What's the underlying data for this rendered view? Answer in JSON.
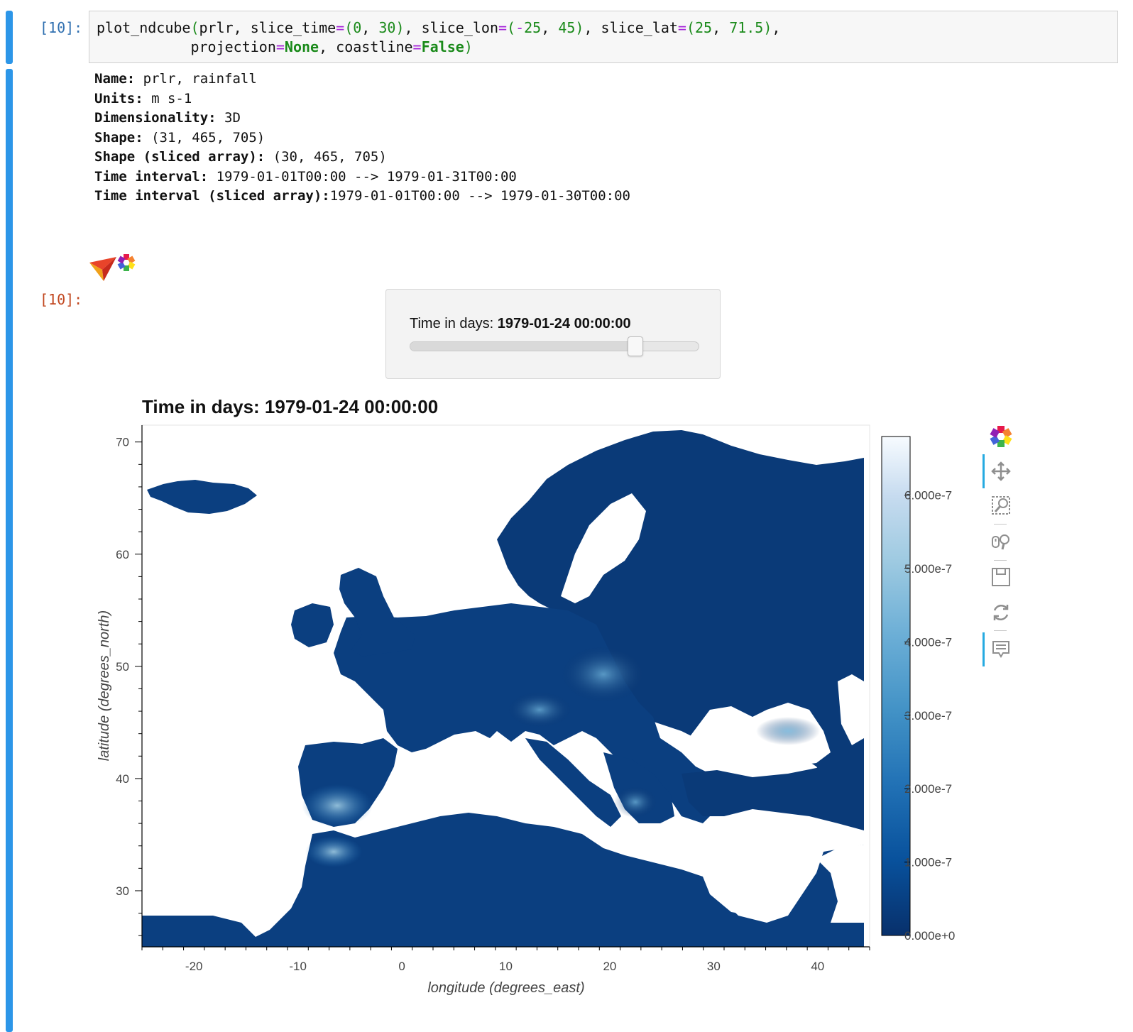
{
  "cell_in": {
    "prompt": "[10]:",
    "code_line1": [
      {
        "t": "plot_ndcube",
        "c": ""
      },
      {
        "t": "(",
        "c": "c-paren"
      },
      {
        "t": "prlr, slice_time",
        "c": ""
      },
      {
        "t": "=",
        "c": "c-op"
      },
      {
        "t": "(",
        "c": "c-paren"
      },
      {
        "t": "0",
        "c": "c-num"
      },
      {
        "t": ", ",
        "c": ""
      },
      {
        "t": "30",
        "c": "c-num"
      },
      {
        "t": ")",
        "c": "c-paren"
      },
      {
        "t": ", slice_lon",
        "c": ""
      },
      {
        "t": "=",
        "c": "c-op"
      },
      {
        "t": "(",
        "c": "c-paren"
      },
      {
        "t": "-",
        "c": "c-op"
      },
      {
        "t": "25",
        "c": "c-num"
      },
      {
        "t": ", ",
        "c": ""
      },
      {
        "t": "45",
        "c": "c-num"
      },
      {
        "t": ")",
        "c": "c-paren"
      },
      {
        "t": ", slice_lat",
        "c": ""
      },
      {
        "t": "=",
        "c": "c-op"
      },
      {
        "t": "(",
        "c": "c-paren"
      },
      {
        "t": "25",
        "c": "c-num"
      },
      {
        "t": ", ",
        "c": ""
      },
      {
        "t": "71.5",
        "c": "c-num"
      },
      {
        "t": ")",
        "c": "c-paren"
      },
      {
        "t": ",",
        "c": ""
      }
    ],
    "code_line2": [
      {
        "t": "           projection",
        "c": ""
      },
      {
        "t": "=",
        "c": "c-op"
      },
      {
        "t": "None",
        "c": "c-kw"
      },
      {
        "t": ", coastline",
        "c": ""
      },
      {
        "t": "=",
        "c": "c-op"
      },
      {
        "t": "False",
        "c": "c-kw"
      },
      {
        "t": ")",
        "c": "c-paren"
      }
    ]
  },
  "cell_out": {
    "prompt": "[10]:",
    "info": [
      {
        "key": "Name:",
        "value": " prlr, rainfall"
      },
      {
        "key": "Units:",
        "value": " m s-1"
      },
      {
        "key": "Dimensionality:",
        "value": " 3D"
      },
      {
        "key": "Shape:",
        "value": " (31, 465, 705)"
      },
      {
        "key": "Shape (sliced array):",
        "value": " (30, 465, 705)"
      },
      {
        "key": "Time interval:",
        "value": " 1979-01-01T00:00 --> 1979-01-31T00:00"
      },
      {
        "key": "Time interval (sliced array):",
        "value": "1979-01-01T00:00 --> 1979-01-30T00:00"
      }
    ]
  },
  "slider": {
    "label": "Time in days: ",
    "value": "1979-01-24 00:00:00",
    "position_fraction": 0.793
  },
  "plot": {
    "title": "Time in days: 1979-01-24 00:00:00"
  },
  "chart_data": {
    "type": "heatmap",
    "title": "Time in days: 1979-01-24 00:00:00",
    "xlabel": "longitude (degrees_east)",
    "ylabel": "latitude (degrees_north)",
    "xlim": [
      -25,
      45
    ],
    "ylim": [
      25,
      71.5
    ],
    "x_ticks": [
      -20,
      -10,
      0,
      10,
      20,
      30,
      40
    ],
    "y_ticks": [
      30,
      40,
      50,
      60,
      70
    ],
    "colorbar": {
      "colormap": "Blues_r",
      "range": [
        0,
        6.8e-07
      ],
      "ticks": [
        0,
        1e-07,
        2e-07,
        3e-07,
        4e-07,
        5e-07,
        6e-07
      ],
      "tick_labels": [
        "0.000e+0",
        "1.000e-7",
        "2.000e-7",
        "3.000e-7",
        "4.000e-7",
        "5.000e-7",
        "6.000e-7"
      ]
    },
    "colors": {
      "low": "#08306b",
      "high": "#f7fbff"
    }
  },
  "toolbar": {
    "items": [
      "bokeh-logo-icon",
      "pan-icon",
      "box-zoom-icon",
      "wheel-zoom-icon",
      "save-icon",
      "reset-icon",
      "hover-icon"
    ]
  }
}
